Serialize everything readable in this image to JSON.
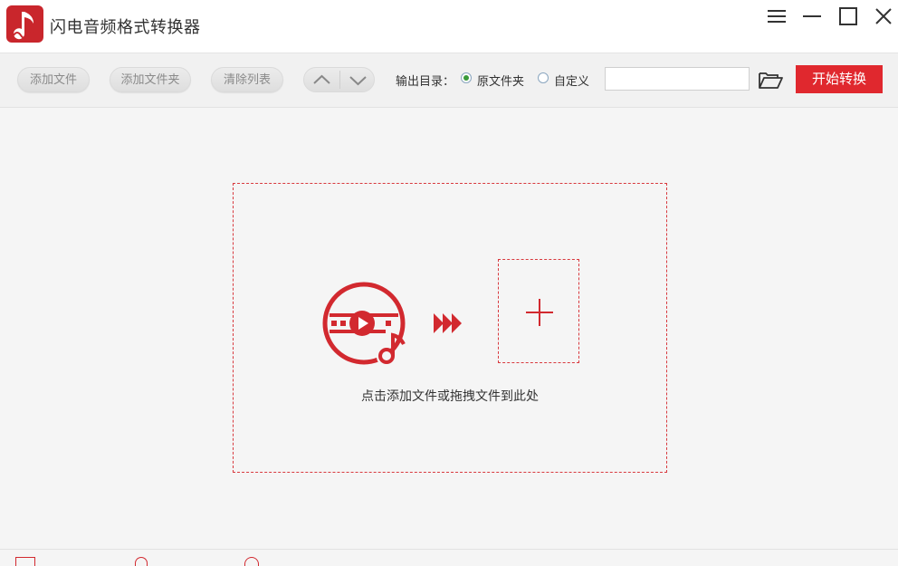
{
  "app": {
    "title": "闪电音频格式转换器"
  },
  "toolbar": {
    "add_file_label": "添加文件",
    "add_folder_label": "添加文件夹",
    "clear_list_label": "清除列表",
    "output_dir_label": "输出目录：",
    "option_original_folder": "原文件夹",
    "option_custom": "自定义",
    "selected_output_option": "原文件夹",
    "output_path_value": "",
    "start_label": "开始转换"
  },
  "dropzone": {
    "hint": "点击添加文件或拖拽文件到此处"
  },
  "colors": {
    "accent": "#e0282e",
    "logo_bg": "#c9262c",
    "selected_radio": "#3a9a3a"
  },
  "icons": {
    "logo": "music-note-icon",
    "menu": "hamburger-menu-icon",
    "minimize": "minimize-icon",
    "maximize": "maximize-icon",
    "close": "close-icon",
    "up": "chevron-up-icon",
    "down": "chevron-down-icon",
    "folder": "open-folder-icon",
    "disc": "music-video-disc-icon",
    "arrows": "triple-forward-arrow-icon",
    "add": "plus-icon"
  }
}
